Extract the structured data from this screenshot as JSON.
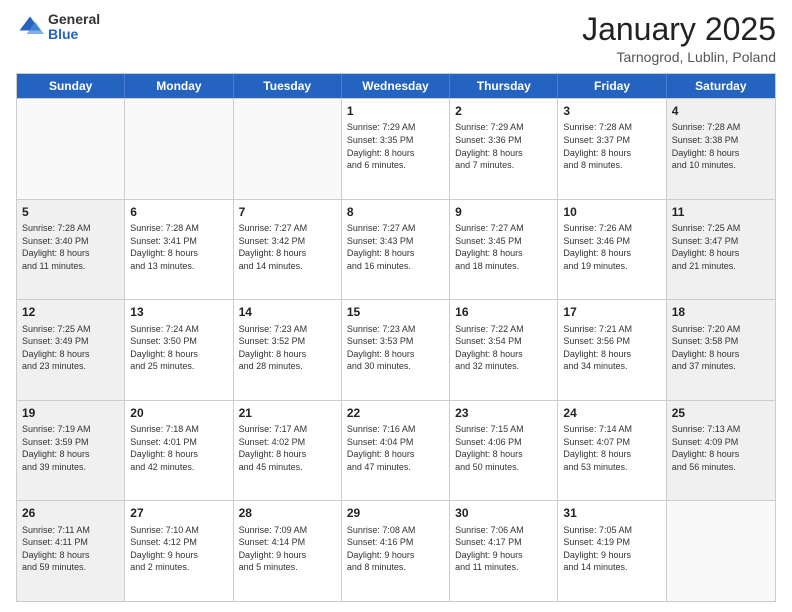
{
  "logo": {
    "general": "General",
    "blue": "Blue"
  },
  "title": "January 2025",
  "location": "Tarnogrod, Lublin, Poland",
  "days_of_week": [
    "Sunday",
    "Monday",
    "Tuesday",
    "Wednesday",
    "Thursday",
    "Friday",
    "Saturday"
  ],
  "weeks": [
    [
      {
        "day": "",
        "info": "",
        "empty": true
      },
      {
        "day": "",
        "info": "",
        "empty": true
      },
      {
        "day": "",
        "info": "",
        "empty": true
      },
      {
        "day": "1",
        "info": "Sunrise: 7:29 AM\nSunset: 3:35 PM\nDaylight: 8 hours\nand 6 minutes.",
        "empty": false
      },
      {
        "day": "2",
        "info": "Sunrise: 7:29 AM\nSunset: 3:36 PM\nDaylight: 8 hours\nand 7 minutes.",
        "empty": false
      },
      {
        "day": "3",
        "info": "Sunrise: 7:28 AM\nSunset: 3:37 PM\nDaylight: 8 hours\nand 8 minutes.",
        "empty": false
      },
      {
        "day": "4",
        "info": "Sunrise: 7:28 AM\nSunset: 3:38 PM\nDaylight: 8 hours\nand 10 minutes.",
        "empty": false,
        "shaded": true
      }
    ],
    [
      {
        "day": "5",
        "info": "Sunrise: 7:28 AM\nSunset: 3:40 PM\nDaylight: 8 hours\nand 11 minutes.",
        "empty": false,
        "shaded": true
      },
      {
        "day": "6",
        "info": "Sunrise: 7:28 AM\nSunset: 3:41 PM\nDaylight: 8 hours\nand 13 minutes.",
        "empty": false
      },
      {
        "day": "7",
        "info": "Sunrise: 7:27 AM\nSunset: 3:42 PM\nDaylight: 8 hours\nand 14 minutes.",
        "empty": false
      },
      {
        "day": "8",
        "info": "Sunrise: 7:27 AM\nSunset: 3:43 PM\nDaylight: 8 hours\nand 16 minutes.",
        "empty": false
      },
      {
        "day": "9",
        "info": "Sunrise: 7:27 AM\nSunset: 3:45 PM\nDaylight: 8 hours\nand 18 minutes.",
        "empty": false
      },
      {
        "day": "10",
        "info": "Sunrise: 7:26 AM\nSunset: 3:46 PM\nDaylight: 8 hours\nand 19 minutes.",
        "empty": false
      },
      {
        "day": "11",
        "info": "Sunrise: 7:25 AM\nSunset: 3:47 PM\nDaylight: 8 hours\nand 21 minutes.",
        "empty": false,
        "shaded": true
      }
    ],
    [
      {
        "day": "12",
        "info": "Sunrise: 7:25 AM\nSunset: 3:49 PM\nDaylight: 8 hours\nand 23 minutes.",
        "empty": false,
        "shaded": true
      },
      {
        "day": "13",
        "info": "Sunrise: 7:24 AM\nSunset: 3:50 PM\nDaylight: 8 hours\nand 25 minutes.",
        "empty": false
      },
      {
        "day": "14",
        "info": "Sunrise: 7:23 AM\nSunset: 3:52 PM\nDaylight: 8 hours\nand 28 minutes.",
        "empty": false
      },
      {
        "day": "15",
        "info": "Sunrise: 7:23 AM\nSunset: 3:53 PM\nDaylight: 8 hours\nand 30 minutes.",
        "empty": false
      },
      {
        "day": "16",
        "info": "Sunrise: 7:22 AM\nSunset: 3:54 PM\nDaylight: 8 hours\nand 32 minutes.",
        "empty": false
      },
      {
        "day": "17",
        "info": "Sunrise: 7:21 AM\nSunset: 3:56 PM\nDaylight: 8 hours\nand 34 minutes.",
        "empty": false
      },
      {
        "day": "18",
        "info": "Sunrise: 7:20 AM\nSunset: 3:58 PM\nDaylight: 8 hours\nand 37 minutes.",
        "empty": false,
        "shaded": true
      }
    ],
    [
      {
        "day": "19",
        "info": "Sunrise: 7:19 AM\nSunset: 3:59 PM\nDaylight: 8 hours\nand 39 minutes.",
        "empty": false,
        "shaded": true
      },
      {
        "day": "20",
        "info": "Sunrise: 7:18 AM\nSunset: 4:01 PM\nDaylight: 8 hours\nand 42 minutes.",
        "empty": false
      },
      {
        "day": "21",
        "info": "Sunrise: 7:17 AM\nSunset: 4:02 PM\nDaylight: 8 hours\nand 45 minutes.",
        "empty": false
      },
      {
        "day": "22",
        "info": "Sunrise: 7:16 AM\nSunset: 4:04 PM\nDaylight: 8 hours\nand 47 minutes.",
        "empty": false
      },
      {
        "day": "23",
        "info": "Sunrise: 7:15 AM\nSunset: 4:06 PM\nDaylight: 8 hours\nand 50 minutes.",
        "empty": false
      },
      {
        "day": "24",
        "info": "Sunrise: 7:14 AM\nSunset: 4:07 PM\nDaylight: 8 hours\nand 53 minutes.",
        "empty": false
      },
      {
        "day": "25",
        "info": "Sunrise: 7:13 AM\nSunset: 4:09 PM\nDaylight: 8 hours\nand 56 minutes.",
        "empty": false,
        "shaded": true
      }
    ],
    [
      {
        "day": "26",
        "info": "Sunrise: 7:11 AM\nSunset: 4:11 PM\nDaylight: 8 hours\nand 59 minutes.",
        "empty": false,
        "shaded": true
      },
      {
        "day": "27",
        "info": "Sunrise: 7:10 AM\nSunset: 4:12 PM\nDaylight: 9 hours\nand 2 minutes.",
        "empty": false
      },
      {
        "day": "28",
        "info": "Sunrise: 7:09 AM\nSunset: 4:14 PM\nDaylight: 9 hours\nand 5 minutes.",
        "empty": false
      },
      {
        "day": "29",
        "info": "Sunrise: 7:08 AM\nSunset: 4:16 PM\nDaylight: 9 hours\nand 8 minutes.",
        "empty": false
      },
      {
        "day": "30",
        "info": "Sunrise: 7:06 AM\nSunset: 4:17 PM\nDaylight: 9 hours\nand 11 minutes.",
        "empty": false
      },
      {
        "day": "31",
        "info": "Sunrise: 7:05 AM\nSunset: 4:19 PM\nDaylight: 9 hours\nand 14 minutes.",
        "empty": false
      },
      {
        "day": "",
        "info": "",
        "empty": true,
        "shaded": true
      }
    ]
  ]
}
